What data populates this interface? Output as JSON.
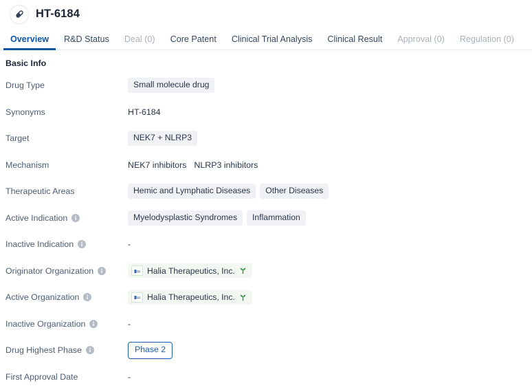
{
  "header": {
    "title": "HT-6184",
    "avatar_icon": "capsule-pill-icon"
  },
  "tabs": [
    {
      "label": "Overview",
      "state": "active"
    },
    {
      "label": "R&D Status",
      "state": "normal"
    },
    {
      "label": "Deal (0)",
      "state": "disabled"
    },
    {
      "label": "Core Patent",
      "state": "normal"
    },
    {
      "label": "Clinical Trial Analysis",
      "state": "normal"
    },
    {
      "label": "Clinical Result",
      "state": "normal"
    },
    {
      "label": "Approval (0)",
      "state": "disabled"
    },
    {
      "label": "Regulation (0)",
      "state": "disabled"
    }
  ],
  "section": {
    "title": "Basic Info"
  },
  "fields": {
    "drug_type": {
      "label": "Drug Type",
      "has_info": false,
      "tags": [
        "Small molecule drug"
      ]
    },
    "synonyms": {
      "label": "Synonyms",
      "has_info": false,
      "text": "HT-6184"
    },
    "target": {
      "label": "Target",
      "has_info": false,
      "tags": [
        "NEK7 + NLRP3"
      ]
    },
    "mechanism": {
      "label": "Mechanism",
      "has_info": false,
      "items": [
        "NEK7 inhibitors",
        "NLRP3 inhibitors"
      ]
    },
    "therapeutic_areas": {
      "label": "Therapeutic Areas",
      "has_info": false,
      "tags": [
        "Hemic and Lymphatic Diseases",
        "Other Diseases"
      ]
    },
    "active_indication": {
      "label": "Active Indication",
      "has_info": true,
      "tags": [
        "Myelodysplastic Syndromes",
        "Inflammation"
      ]
    },
    "inactive_indication": {
      "label": "Inactive Indication",
      "has_info": true,
      "text": "-"
    },
    "originator_organization": {
      "label": "Originator Organization",
      "has_info": true,
      "org": "Halia Therapeutics, Inc."
    },
    "active_organization": {
      "label": "Active Organization",
      "has_info": true,
      "org": "Halia Therapeutics, Inc."
    },
    "inactive_organization": {
      "label": "Inactive Organization",
      "has_info": true,
      "text": "-"
    },
    "drug_highest_phase": {
      "label": "Drug Highest Phase",
      "has_info": true,
      "badge": "Phase 2"
    },
    "first_approval_date": {
      "label": "First Approval Date",
      "has_info": false,
      "text": "-"
    }
  },
  "colors": {
    "accent_blue": "#0b54a6",
    "tag_grey": "#f0f1f4",
    "org_green_bg": "#f2f8f1",
    "sprout_green": "#2f8a3d",
    "label_grey": "#4d5c73",
    "disabled_grey": "#a8b0bd"
  }
}
